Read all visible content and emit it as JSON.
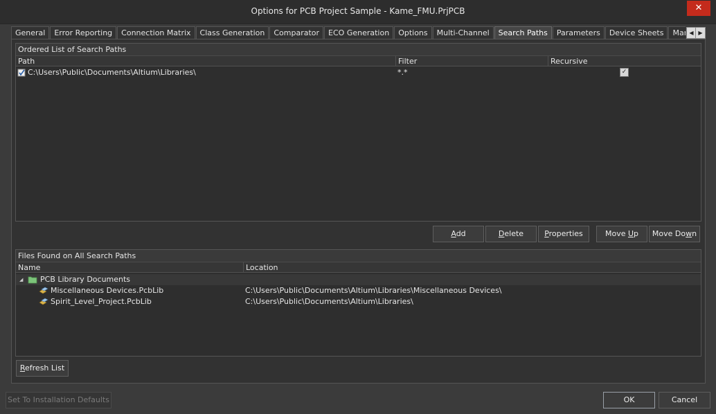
{
  "window": {
    "title": "Options for PCB Project Sample - Kame_FMU.PrjPCB",
    "close_glyph": "✕"
  },
  "tabs": [
    {
      "label": "General"
    },
    {
      "label": "Error Reporting"
    },
    {
      "label": "Connection Matrix"
    },
    {
      "label": "Class Generation"
    },
    {
      "label": "Comparator"
    },
    {
      "label": "ECO Generation"
    },
    {
      "label": "Options"
    },
    {
      "label": "Multi-Channel"
    },
    {
      "label": "Search Paths",
      "active": true
    },
    {
      "label": "Parameters"
    },
    {
      "label": "Device Sheets"
    },
    {
      "label": "Managed Outputs"
    }
  ],
  "tab_scroll": {
    "left_glyph": "◀",
    "right_glyph": "▶"
  },
  "search_paths": {
    "title": "Ordered List of Search Paths",
    "columns": {
      "path": "Path",
      "filter": "Filter",
      "recursive": "Recursive"
    },
    "rows": [
      {
        "path": "C:\\Users\\Public\\Documents\\Altium\\Libraries\\",
        "filter": "*.*",
        "recursive": true
      }
    ]
  },
  "path_buttons": {
    "add_pre": "",
    "add_ul": "A",
    "add_post": "dd",
    "delete_pre": "",
    "delete_ul": "D",
    "delete_post": "elete",
    "properties_pre": "",
    "properties_ul": "P",
    "properties_post": "roperties",
    "moveup_pre": "Move ",
    "moveup_ul": "U",
    "moveup_post": "p",
    "movedown_pre": "Move Do",
    "movedown_ul": "w",
    "movedown_post": "n"
  },
  "files_found": {
    "title": "Files Found on All Search Paths",
    "columns": {
      "name": "Name",
      "location": "Location"
    },
    "group": {
      "label": "PCB Library Documents",
      "expand_glyph": "◢"
    },
    "files": [
      {
        "name": "Miscellaneous Devices.PcbLib",
        "location": "C:\\Users\\Public\\Documents\\Altium\\Libraries\\Miscellaneous Devices\\"
      },
      {
        "name": "Spirit_Level_Project.PcbLib",
        "location": "C:\\Users\\Public\\Documents\\Altium\\Libraries\\"
      }
    ]
  },
  "refresh_button": {
    "pre": "",
    "ul": "R",
    "post": "efresh List"
  },
  "footer": {
    "defaults_label": "Set To Installation Defaults",
    "ok_label": "OK",
    "cancel_label": "Cancel"
  },
  "colors": {
    "background": "#3b3b3b",
    "close_button": "#c42b1c",
    "folder_icon": "#7cc47a"
  }
}
